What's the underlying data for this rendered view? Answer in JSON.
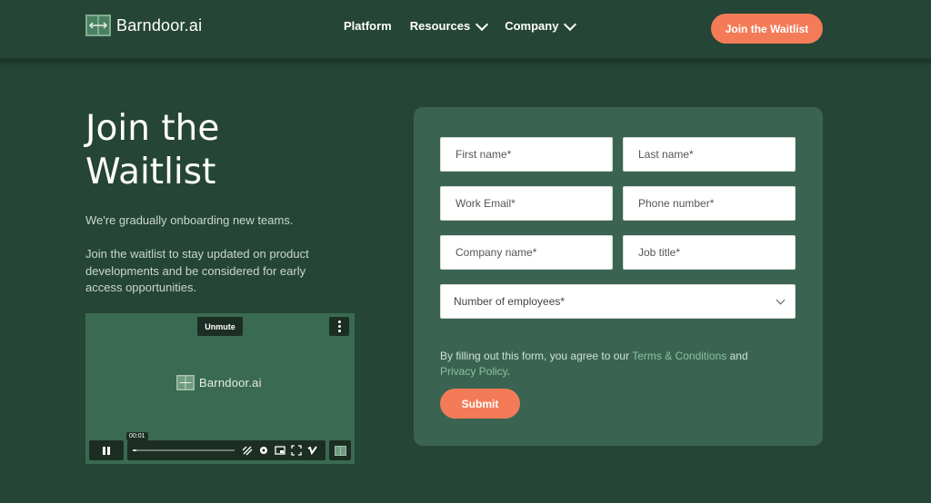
{
  "brand": {
    "name": "Barndoor.ai",
    "accent": "#f47b58",
    "background": "#254536",
    "card": "#3a6451"
  },
  "nav": {
    "items": [
      {
        "label": "Platform",
        "dropdown": false
      },
      {
        "label": "Resources",
        "dropdown": true
      },
      {
        "label": "Company",
        "dropdown": true
      }
    ],
    "cta_label": "Join the Waitlist"
  },
  "hero": {
    "title": "Join the Waitlist",
    "paragraph1": "We're gradually onboarding new teams.",
    "paragraph2": "Join the waitlist to stay updated on product developments and be considered for early access opportunities."
  },
  "video": {
    "unmute_label": "Unmute",
    "logo_text": "Barndoor.ai",
    "time": "00:01",
    "progress": 0.04,
    "icons": [
      "play-pause-icon",
      "no-captions-icon",
      "settings-icon",
      "pip-icon",
      "fullscreen-icon",
      "vimeo-icon",
      "barndoor-logo-icon"
    ]
  },
  "form": {
    "fields": {
      "first_name": "First name*",
      "last_name": "Last name*",
      "work_email": "Work Email*",
      "phone": "Phone number*",
      "company": "Company name*",
      "job_title": "Job title*"
    },
    "employees_select": "Number of employees*",
    "consent_pre": "By filling out this form, you agree to our ",
    "terms_link": "Terms & Conditions",
    "consent_mid": " and",
    "privacy_link": "Privacy Policy",
    "consent_end": ".",
    "submit_label": "Submit"
  }
}
